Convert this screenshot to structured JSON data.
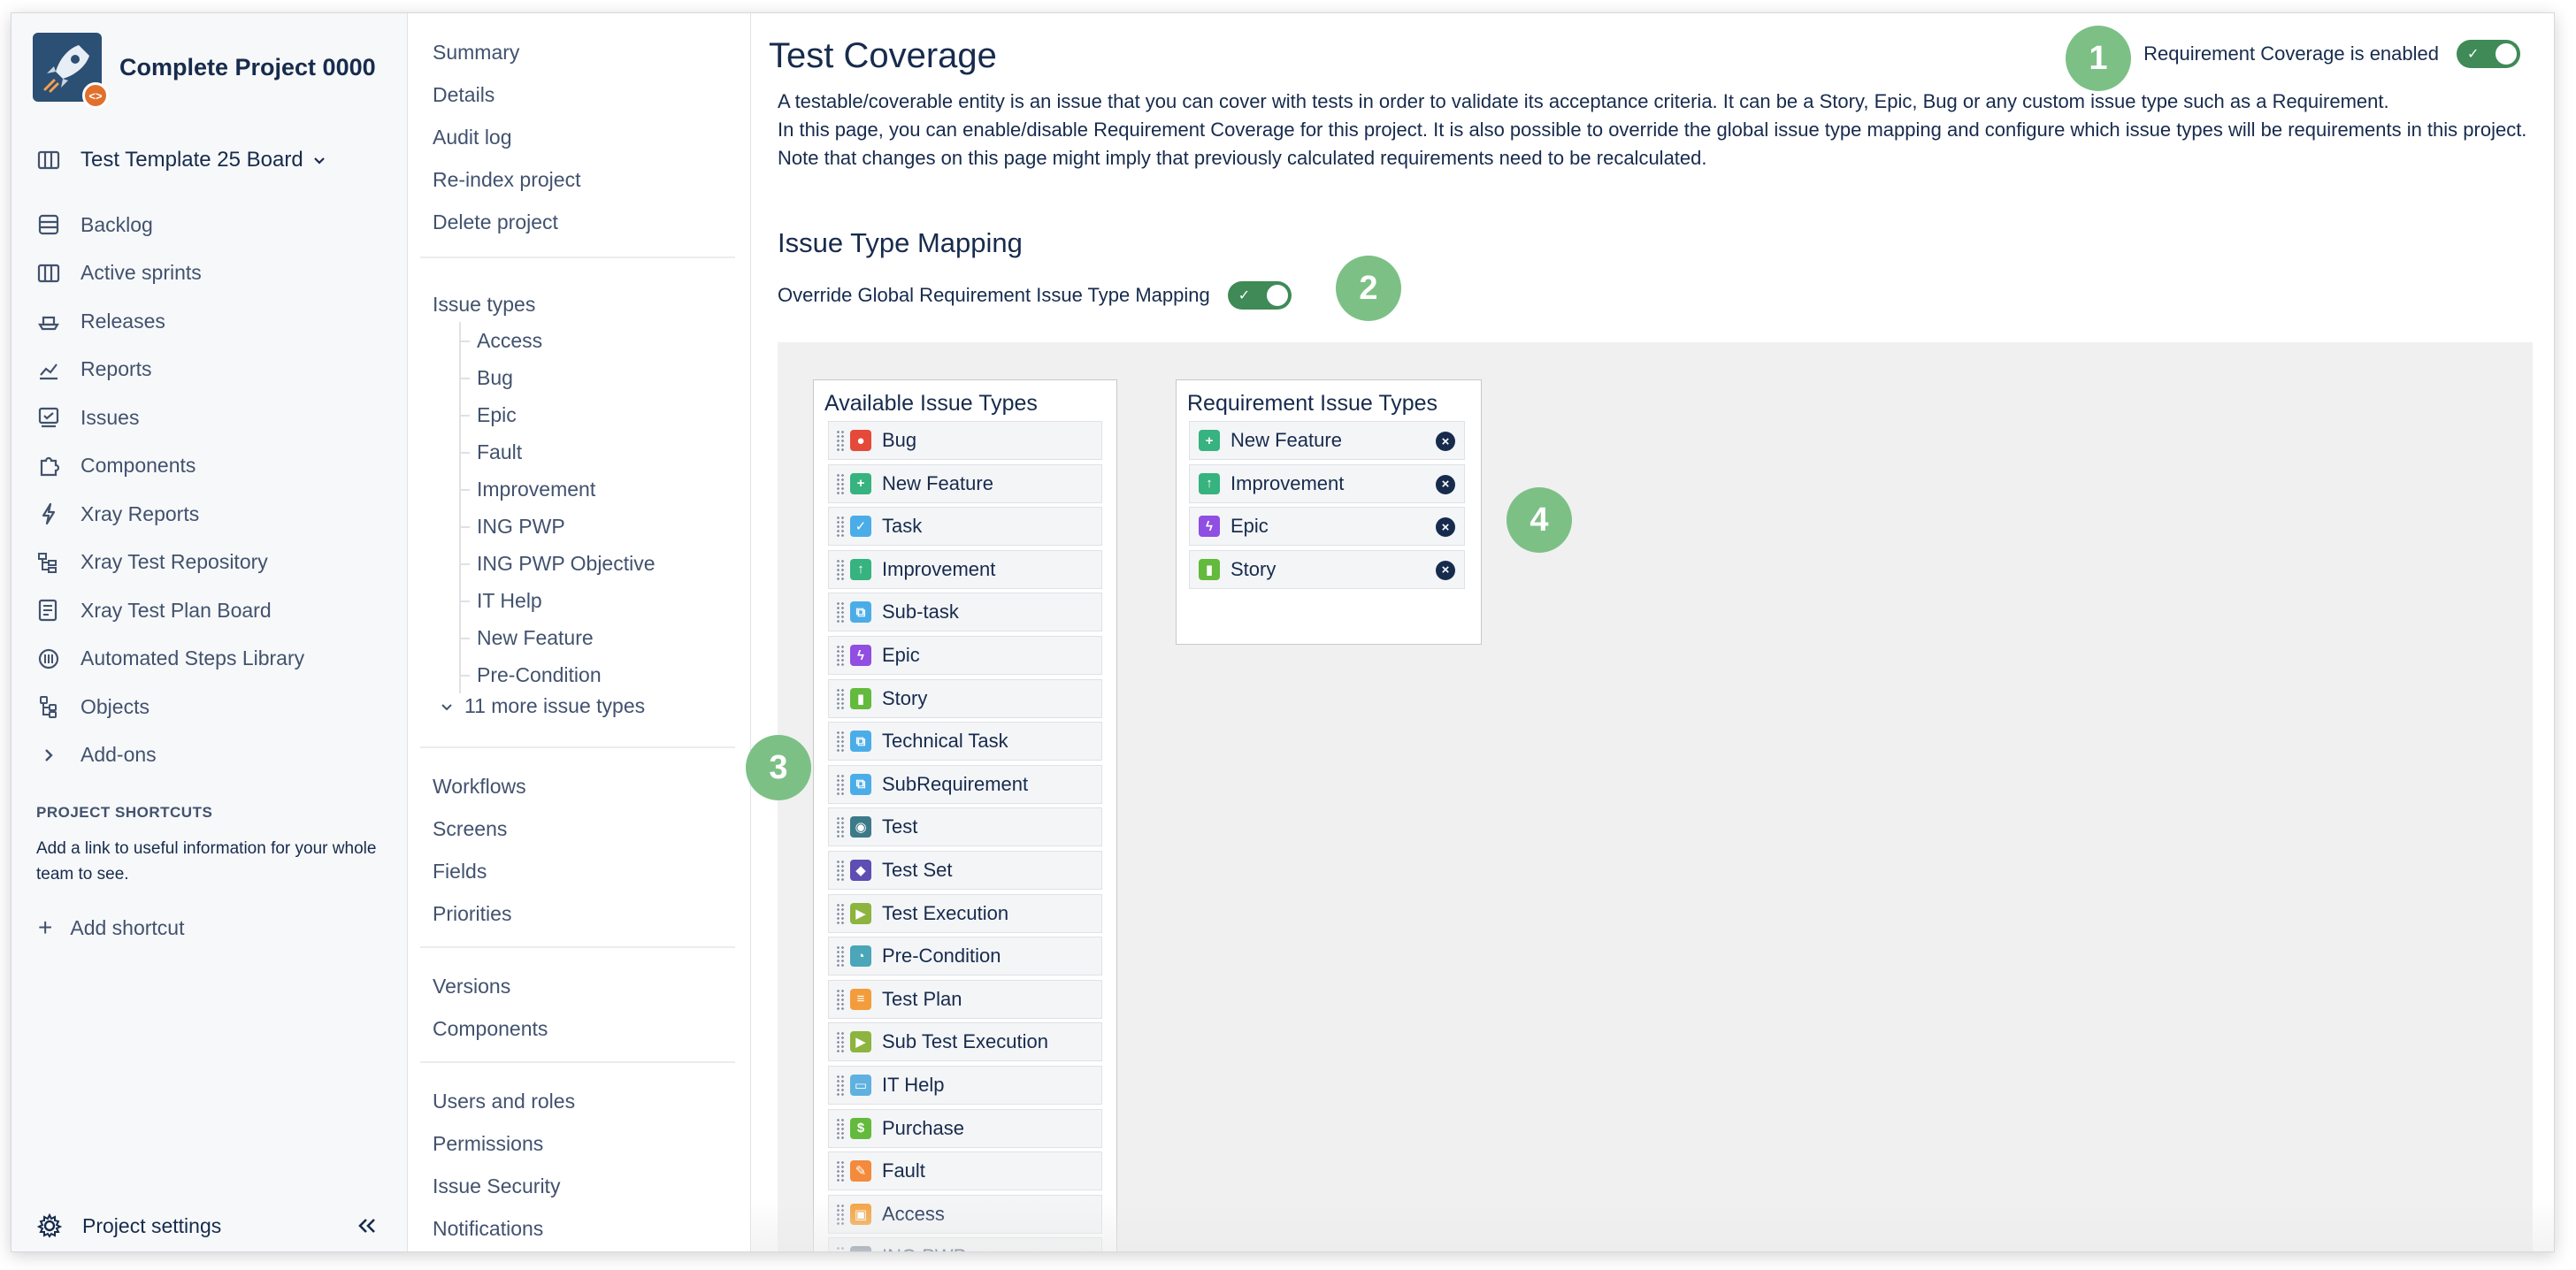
{
  "project": {
    "name": "Complete Project 0000",
    "board": "Test Template 25 Board"
  },
  "sidebar": {
    "items": [
      {
        "label": "Backlog",
        "icon": "backlog-icon"
      },
      {
        "label": "Active sprints",
        "icon": "board-icon"
      },
      {
        "label": "Releases",
        "icon": "ship-icon"
      },
      {
        "label": "Reports",
        "icon": "chart-icon"
      },
      {
        "label": "Issues",
        "icon": "issues-icon"
      },
      {
        "label": "Components",
        "icon": "puzzle-icon"
      },
      {
        "label": "Xray Reports",
        "icon": "bolt-icon"
      },
      {
        "label": "Xray Test Repository",
        "icon": "repository-icon"
      },
      {
        "label": "Xray Test Plan Board",
        "icon": "plan-board-icon"
      },
      {
        "label": "Automated Steps Library",
        "icon": "library-icon"
      },
      {
        "label": "Objects",
        "icon": "objects-icon"
      },
      {
        "label": "Add-ons",
        "icon": "chevron-right-icon"
      }
    ],
    "shortcuts_title": "PROJECT SHORTCUTS",
    "shortcuts_text": "Add a link to useful information for your whole team to see.",
    "add_shortcut": "Add shortcut",
    "settings_label": "Project settings"
  },
  "subnav": {
    "group1": [
      "Summary",
      "Details",
      "Audit log",
      "Re-index project",
      "Delete project"
    ],
    "issue_types_label": "Issue types",
    "issue_types": [
      "Access",
      "Bug",
      "Epic",
      "Fault",
      "Improvement",
      "ING PWP",
      "ING PWP Objective",
      "IT Help",
      "New Feature",
      "Pre-Condition"
    ],
    "more_types": "11 more issue types",
    "group2": [
      "Workflows",
      "Screens",
      "Fields",
      "Priorities"
    ],
    "group3": [
      "Versions",
      "Components"
    ],
    "group4": [
      "Users and roles",
      "Permissions",
      "Issue Security",
      "Notifications"
    ]
  },
  "main": {
    "title": "Test Coverage",
    "coverage_label": "Requirement Coverage is enabled",
    "coverage_enabled": true,
    "description": [
      "A testable/coverable entity is an issue that you can cover with tests in order to validate its acceptance criteria. It can be a Story, Epic, Bug or any custom issue type such as a Requirement.",
      "In this page, you can enable/disable Requirement Coverage for this project. It is also possible to override the global issue type mapping and configure which issue types will be requirements in this project.",
      "Note that changes on this page might imply that previously calculated requirements need to be recalculated."
    ],
    "mapping_title": "Issue Type Mapping",
    "override_label": "Override Global Requirement Issue Type Mapping",
    "override_enabled": true,
    "available_title": "Available Issue Types",
    "available": [
      {
        "label": "Bug",
        "color": "#e5493a",
        "glyph": "●"
      },
      {
        "label": "New Feature",
        "color": "#36b37e",
        "glyph": "+"
      },
      {
        "label": "Task",
        "color": "#4bade8",
        "glyph": "✓"
      },
      {
        "label": "Improvement",
        "color": "#36b37e",
        "glyph": "↑"
      },
      {
        "label": "Sub-task",
        "color": "#4bade8",
        "glyph": "⧉"
      },
      {
        "label": "Epic",
        "color": "#904ee2",
        "glyph": "ϟ"
      },
      {
        "label": "Story",
        "color": "#63ba3c",
        "glyph": "▮"
      },
      {
        "label": "Technical Task",
        "color": "#4bade8",
        "glyph": "⧉"
      },
      {
        "label": "SubRequirement",
        "color": "#4bade8",
        "glyph": "⧉"
      },
      {
        "label": "Test",
        "color": "#3c7a8a",
        "glyph": "◉"
      },
      {
        "label": "Test Set",
        "color": "#5e4db2",
        "glyph": "◆"
      },
      {
        "label": "Test Execution",
        "color": "#8db43e",
        "glyph": "▶"
      },
      {
        "label": "Pre-Condition",
        "color": "#4aa6b8",
        "glyph": "◔"
      },
      {
        "label": "Test Plan",
        "color": "#f39c3c",
        "glyph": "≡"
      },
      {
        "label": "Sub Test Execution",
        "color": "#8db43e",
        "glyph": "▶"
      },
      {
        "label": "IT Help",
        "color": "#5fb1e0",
        "glyph": "▭"
      },
      {
        "label": "Purchase",
        "color": "#63ba3c",
        "glyph": "$"
      },
      {
        "label": "Fault",
        "color": "#f38a3c",
        "glyph": "✎"
      },
      {
        "label": "Access",
        "color": "#f3a13c",
        "glyph": "▣"
      },
      {
        "label": "ING PWP",
        "color": "#6b778c",
        "glyph": "◎"
      }
    ],
    "requirement_title": "Requirement Issue Types",
    "requirements": [
      {
        "label": "New Feature",
        "color": "#36b37e",
        "glyph": "+"
      },
      {
        "label": "Improvement",
        "color": "#36b37e",
        "glyph": "↑"
      },
      {
        "label": "Epic",
        "color": "#904ee2",
        "glyph": "ϟ"
      },
      {
        "label": "Story",
        "color": "#63ba3c",
        "glyph": "▮"
      }
    ],
    "remove_glyph": "×"
  },
  "callouts": [
    "1",
    "2",
    "3",
    "4"
  ],
  "colors": {
    "toggle_on": "#3f8a56",
    "callout": "#7cc085",
    "sidebar_bg": "#f7f8f9"
  }
}
